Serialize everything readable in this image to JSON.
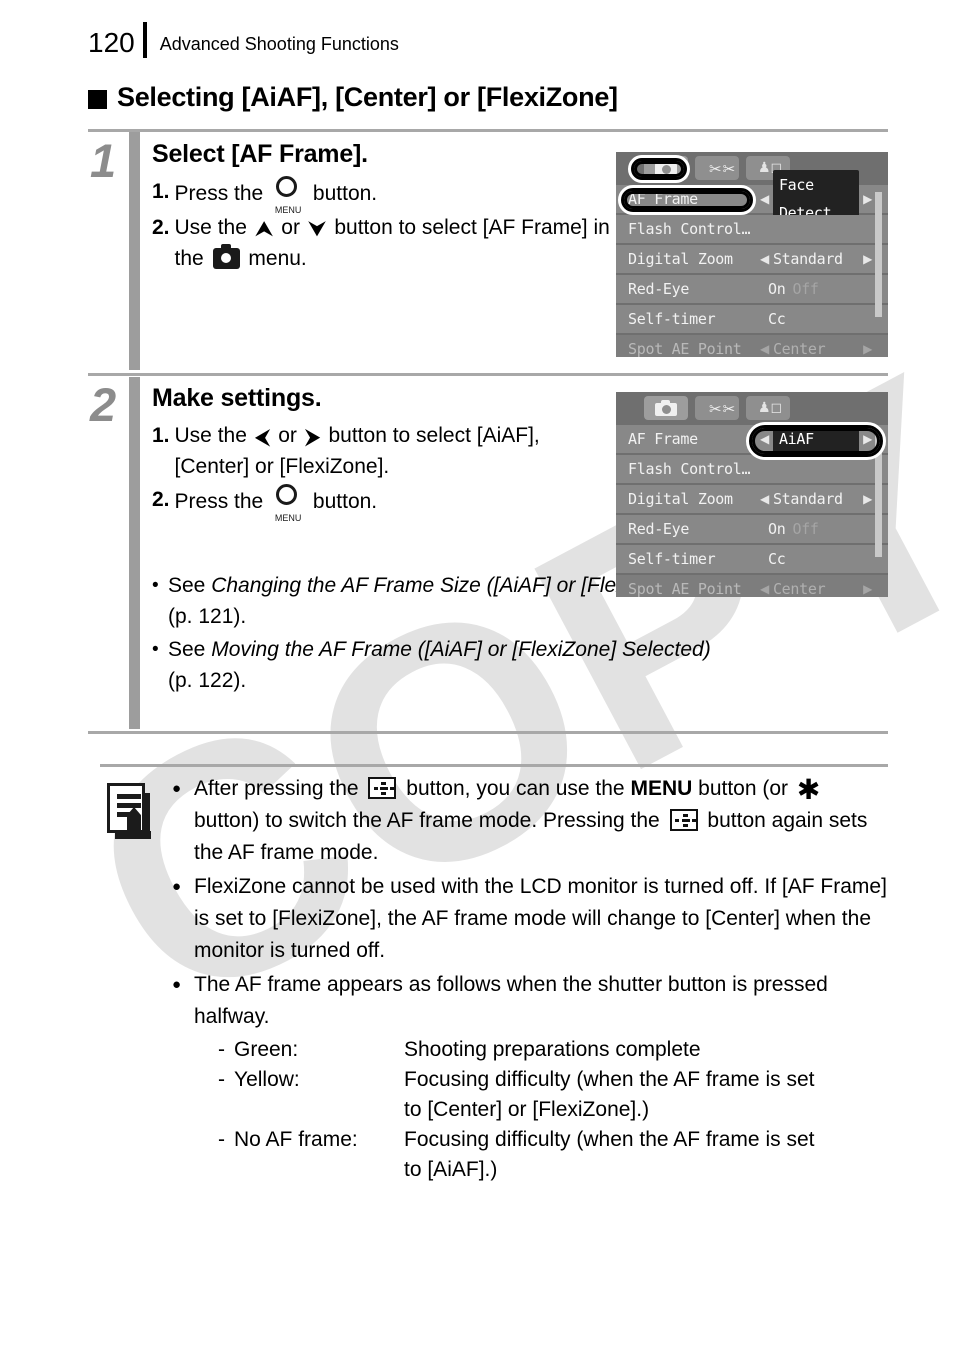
{
  "header": {
    "page_number": "120",
    "title": "Advanced Shooting Functions"
  },
  "section": {
    "heading": "Selecting [AiAF], [Center] or [FlexiZone]"
  },
  "steps": [
    {
      "number": "1",
      "title": "Select [AF Frame].",
      "substeps": [
        {
          "num": "1.",
          "pre": "Press the",
          "icon": "menu-button-icon",
          "post": "button."
        },
        {
          "num": "2.",
          "pre": "Use the",
          "icon_up": "up-arrow-icon",
          "mid_or": "or",
          "icon_down": "down-arrow-icon",
          "post": "button to select [AF Frame] in the",
          "icon_menu": "camera-menu-icon",
          "tail": "menu."
        }
      ]
    },
    {
      "number": "2",
      "title": "Make settings.",
      "substeps": [
        {
          "num": "1.",
          "pre": "Use the",
          "icon_left": "left-arrow-icon",
          "mid_or": "or",
          "icon_right": "right-arrow-icon",
          "post": "button to select [AiAF], [Center] or [FlexiZone]."
        },
        {
          "num": "2.",
          "pre": "Press the",
          "icon": "menu-button-icon",
          "post": "button."
        }
      ]
    }
  ],
  "see_also": [
    {
      "bullet": "•",
      "lead": "See ",
      "italic": "Changing the AF Frame Size ([AiAF] or [FlexiZone] Selected)",
      "page_ref": "(p. 121)."
    },
    {
      "bullet": "•",
      "lead": "See ",
      "italic": "Moving the AF Frame ([AiAF] or [FlexiZone] Selected)",
      "page_ref": "(p. 122)."
    }
  ],
  "notes": {
    "icon": "note-pencil-icon",
    "items": [
      {
        "bullet": "●",
        "part1": "After pressing the",
        "icon1": "af-frame-button-icon",
        "part2": "button, you can use the",
        "bold1": "MENU",
        "part3": "button (or",
        "icon2": "star-button-icon",
        "part4": "button) to switch the AF frame mode. Pressing the",
        "icon3": "af-frame-button-icon",
        "part5": "button again sets the AF frame mode."
      },
      {
        "bullet": "●",
        "text": "FlexiZone cannot be used with the LCD monitor is turned off. If [AF Frame] is set to [FlexiZone], the AF frame mode will change to [Center] when the monitor is turned off."
      },
      {
        "bullet": "●",
        "text": "The AF frame appears as follows when the shutter button is pressed halfway.",
        "color_list": [
          {
            "dash": "-",
            "name": "Green:",
            "desc": "Shooting preparations complete",
            "desc2": ""
          },
          {
            "dash": "-",
            "name": "Yellow:",
            "desc": "Focusing difficulty (when the AF frame is set",
            "desc2": "to [Center] or [FlexiZone].)"
          },
          {
            "dash": "-",
            "name": "No AF frame:",
            "desc": "Focusing difficulty (when the AF frame is set",
            "desc2": "to [AiAF].)"
          }
        ]
      }
    ]
  },
  "lcd_screens": [
    {
      "id": "screen-step1",
      "tabs": [
        "camera-tab-icon",
        "tools-tab-icon",
        "my-camera-tab-icon"
      ],
      "selected_tab": 0,
      "rows": [
        {
          "label": "AF Frame",
          "value": "Face Detect",
          "carets": true,
          "highlight": true,
          "dim": false
        },
        {
          "label": "Flash Control…",
          "value": "",
          "carets": false,
          "highlight": false,
          "dim": false
        },
        {
          "label": "Digital Zoom",
          "value": "Standard",
          "carets": true,
          "highlight": false,
          "dim": false
        },
        {
          "label": "Red-Eye",
          "value": "On",
          "value_off": "Off",
          "carets": false,
          "highlight": false,
          "dim": false
        },
        {
          "label": "Self-timer",
          "value": "Cc",
          "carets": false,
          "highlight": false,
          "dim": false
        },
        {
          "label": "Spot AE Point",
          "value": "Center",
          "carets": true,
          "highlight": false,
          "dim": true
        }
      ],
      "ring_label": true,
      "ring_tab": true,
      "ring_value": false
    },
    {
      "id": "screen-step2",
      "tabs": [
        "camera-tab-icon",
        "tools-tab-icon",
        "my-camera-tab-icon"
      ],
      "selected_tab": 0,
      "rows": [
        {
          "label": "AF Frame",
          "value": "AiAF",
          "carets": true,
          "highlight": true,
          "dim": false
        },
        {
          "label": "Flash Control…",
          "value": "",
          "carets": false,
          "highlight": false,
          "dim": false
        },
        {
          "label": "Digital Zoom",
          "value": "Standard",
          "carets": true,
          "highlight": false,
          "dim": false
        },
        {
          "label": "Red-Eye",
          "value": "On",
          "value_off": "Off",
          "carets": false,
          "highlight": false,
          "dim": false
        },
        {
          "label": "Self-timer",
          "value": "Cc",
          "carets": false,
          "highlight": false,
          "dim": false
        },
        {
          "label": "Spot AE Point",
          "value": "Center",
          "carets": true,
          "highlight": false,
          "dim": true
        }
      ],
      "ring_label": false,
      "ring_tab": false,
      "ring_value": true
    }
  ],
  "watermark": {
    "text": "COPY"
  },
  "colors": {
    "rule": "#a8a8a8",
    "step_bar": "#9d9d9d",
    "step_number": "#8c8c8c",
    "lcd_background": "#6f6f6f",
    "lcd_row": "#888888",
    "lcd_row_dim": "#7d7d7d",
    "lcd_text": "#f2f2f2",
    "lcd_text_dim": "#b0b0b0",
    "highlight_fill": "#222222",
    "watermark": "#e2e2e2",
    "ink": "#000000"
  }
}
